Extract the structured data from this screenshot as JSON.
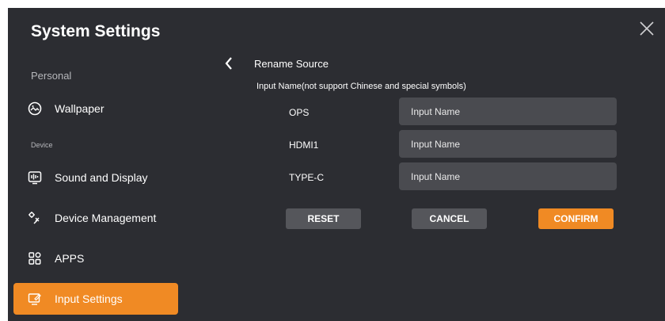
{
  "window": {
    "title": "System Settings",
    "close_icon": "close-icon"
  },
  "sidebar": {
    "sections": [
      "Personal",
      "Device"
    ],
    "items": [
      {
        "label": "Wallpaper",
        "icon": "wallpaper-icon"
      },
      {
        "label": "Sound and Display",
        "icon": "sound-display-icon"
      },
      {
        "label": "Device Management",
        "icon": "device-management-icon"
      },
      {
        "label": "APPS",
        "icon": "apps-icon"
      },
      {
        "label": "Input Settings",
        "icon": "input-settings-icon",
        "active": true
      }
    ]
  },
  "main": {
    "back_icon": "chevron-left-icon",
    "heading": "Rename Source",
    "hint": "Input Name(not support Chinese and special symbols)",
    "rows": [
      {
        "label": "OPS",
        "placeholder": "Input Name",
        "value": ""
      },
      {
        "label": "HDMI1",
        "placeholder": "Input Name",
        "value": ""
      },
      {
        "label": "TYPE-C",
        "placeholder": "Input Name",
        "value": ""
      }
    ],
    "buttons": {
      "reset": "RESET",
      "cancel": "CANCEL",
      "confirm": "CONFIRM"
    }
  },
  "colors": {
    "background": "#2c2d32",
    "accent": "#f08a24",
    "field": "#4a4b50",
    "button_gray": "#55565b"
  }
}
